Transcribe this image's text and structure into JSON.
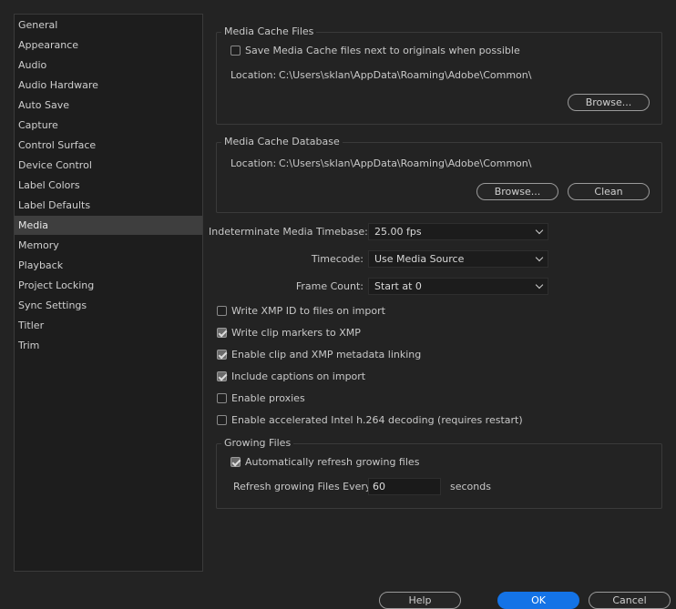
{
  "sidebar": {
    "items": [
      {
        "label": "General"
      },
      {
        "label": "Appearance"
      },
      {
        "label": "Audio"
      },
      {
        "label": "Audio Hardware"
      },
      {
        "label": "Auto Save"
      },
      {
        "label": "Capture"
      },
      {
        "label": "Control Surface"
      },
      {
        "label": "Device Control"
      },
      {
        "label": "Label Colors"
      },
      {
        "label": "Label Defaults"
      },
      {
        "label": "Media"
      },
      {
        "label": "Memory"
      },
      {
        "label": "Playback"
      },
      {
        "label": "Project Locking"
      },
      {
        "label": "Sync Settings"
      },
      {
        "label": "Titler"
      },
      {
        "label": "Trim"
      }
    ],
    "selected": "Media"
  },
  "cache_files": {
    "title": "Media Cache Files",
    "save_next_label": "Save Media Cache files next to originals when possible",
    "save_next_checked": false,
    "location_label": "Location:",
    "location_value": "C:\\Users\\sklan\\AppData\\Roaming\\Adobe\\Common\\",
    "browse_label": "Browse..."
  },
  "cache_db": {
    "title": "Media Cache Database",
    "location_label": "Location:",
    "location_value": "C:\\Users\\sklan\\AppData\\Roaming\\Adobe\\Common\\",
    "browse_label": "Browse...",
    "clean_label": "Clean"
  },
  "fields": {
    "timebase_label": "Indeterminate Media Timebase:",
    "timebase_value": "25.00 fps",
    "timecode_label": "Timecode:",
    "timecode_value": "Use Media Source",
    "framecount_label": "Frame Count:",
    "framecount_value": "Start at 0"
  },
  "options": [
    {
      "label": "Write XMP ID to files on import",
      "checked": false
    },
    {
      "label": "Write clip markers to XMP",
      "checked": true
    },
    {
      "label": "Enable clip and XMP metadata linking",
      "checked": true
    },
    {
      "label": "Include captions on import",
      "checked": true
    },
    {
      "label": "Enable proxies",
      "checked": false
    },
    {
      "label": "Enable accelerated Intel h.264 decoding (requires restart)",
      "checked": false
    }
  ],
  "growing": {
    "title": "Growing Files",
    "auto_refresh_label": "Automatically refresh growing files",
    "auto_refresh_checked": true,
    "refresh_every_label": "Refresh growing Files Every",
    "refresh_value": "60",
    "seconds_label": "seconds"
  },
  "footer": {
    "help_label": "Help",
    "ok_label": "OK",
    "cancel_label": "Cancel"
  },
  "colors": {
    "accent": "#1473e6",
    "background": "#232323",
    "selected_item": "#3e3e3e"
  }
}
